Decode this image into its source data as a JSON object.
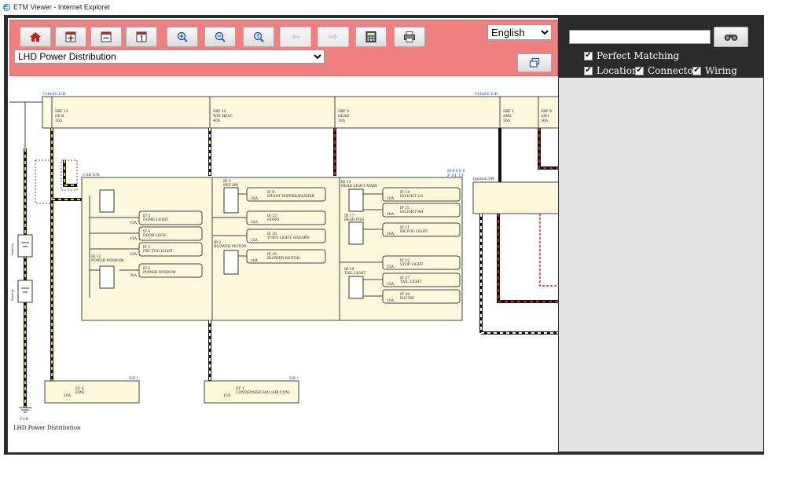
{
  "window": {
    "title": "ETM Viewer - Internet Explorer",
    "icon": "ie-icon"
  },
  "toolbar": {
    "buttons": [
      {
        "name": "home-button",
        "icon": "home-icon",
        "enabled": true
      },
      {
        "name": "expand-button",
        "icon": "plus-box-icon",
        "enabled": true
      },
      {
        "name": "collapse-button",
        "icon": "minus-box-icon",
        "enabled": true
      },
      {
        "name": "fit-page-button",
        "icon": "page-one-icon",
        "enabled": true
      },
      {
        "name": "zoom-in-button",
        "icon": "zoom-in-icon",
        "enabled": true
      },
      {
        "name": "zoom-out-button",
        "icon": "zoom-out-icon",
        "enabled": true
      },
      {
        "name": "zoom-fit-button",
        "icon": "zoom-reset-icon",
        "enabled": true
      },
      {
        "name": "back-button",
        "icon": "arrow-left-icon",
        "enabled": false
      },
      {
        "name": "forward-button",
        "icon": "arrow-right-icon",
        "enabled": false
      },
      {
        "name": "calculator-button",
        "icon": "calculator-icon",
        "enabled": true
      },
      {
        "name": "print-button",
        "icon": "printer-icon",
        "enabled": true
      }
    ],
    "language": {
      "selected": "English"
    },
    "diagram": {
      "selected": "LHD Power Distribution"
    },
    "accent": "#f08080"
  },
  "search": {
    "value": "",
    "button_icon": "binoculars-icon",
    "options": [
      {
        "label": "Perfect Matching",
        "checked": true
      },
      {
        "label": "Location",
        "checked": true
      },
      {
        "label": "Connector",
        "checked": true
      },
      {
        "label": "Wiring",
        "checked": true
      }
    ]
  },
  "diagram_labels": {
    "caption": "LHD Power Distribution",
    "chassis_left": "CHASS E/B",
    "chassis_right": "CHASS E/B",
    "cabin": "CAB E/B",
    "mfuse": "M-FUS 6",
    "mfuse2": "P_FL 13",
    "ignition": "Ignition SW",
    "fcb": "FCB",
    "battery1": "Battery",
    "battery2": "Battery",
    "ew2": "E/B 2",
    "eb1": "E/B 1",
    "top_fuses": [
      {
        "id": "SBF 13",
        "name": "I/E-B",
        "amp": "30A"
      },
      {
        "id": "SBF 10",
        "name": "WIP. HVAC",
        "amp": "40A"
      },
      {
        "id": "SBF 8",
        "name": "HEAD",
        "amp": "30A"
      },
      {
        "id": "SBF 1",
        "name": "AM2",
        "amp": "30A"
      },
      {
        "id": "SBF 9",
        "name": "AM1",
        "amp": "30A"
      }
    ],
    "left_fuses": [
      {
        "id": "IF 5",
        "name": "DOME LIGHT",
        "amp": "15A"
      },
      {
        "id": "IF 4",
        "name": "DOOR LOCK",
        "amp": "15A"
      },
      {
        "id": "IF 5",
        "name": "FRT FOG LIGHT",
        "amp": "15A"
      },
      {
        "id": "IF 6",
        "name": "POWER WINDOW",
        "amp": "30A"
      }
    ],
    "left_relays": [
      "IR 12",
      "POWER WINDOW"
    ],
    "mid_relays": [
      "IR 3",
      "REV ON",
      "IR 2",
      "BLOWER MOTOR"
    ],
    "mid_fuses": [
      {
        "id": "IF 8",
        "name": "FRONT WIPER&WASHER",
        "amp": "20A"
      },
      {
        "id": "IF 23",
        "name": "HORN",
        "amp": "15A"
      },
      {
        "id": "IF 20",
        "name": "TURN LIGHT, HAZARD",
        "amp": "15A"
      },
      {
        "id": "IF 30",
        "name": "BLOWER MOTOR",
        "amp": "20A"
      }
    ],
    "right_relays": [
      "IR 13",
      "HEAD LIGHT MAIN",
      "IR 17",
      "REAR FOG",
      "IR 16",
      "TAIL LIGHT"
    ],
    "right_fuses": [
      {
        "id": "IF 14",
        "name": "H/LIGHT LH",
        "amp": "10A"
      },
      {
        "id": "IF 15",
        "name": "H/LIGHT RH",
        "amp": "10A"
      },
      {
        "id": "IF 11",
        "name": "RR FOG LIGHT",
        "amp": "10A"
      },
      {
        "id": "IF 12",
        "name": "STOP LIGHT",
        "amp": "15A"
      },
      {
        "id": "IF 27",
        "name": "TAIL LIGHT",
        "amp": "15A"
      },
      {
        "id": "IF 28",
        "name": "ILLUMI",
        "amp": "10A"
      }
    ],
    "bottom_fuses": [
      {
        "id": "EF 6",
        "name": "EMS",
        "amp": "20A"
      },
      {
        "id": "EF 1",
        "name": "CONDENSER FAN (AIR CON)",
        "amp": "15A"
      }
    ]
  }
}
